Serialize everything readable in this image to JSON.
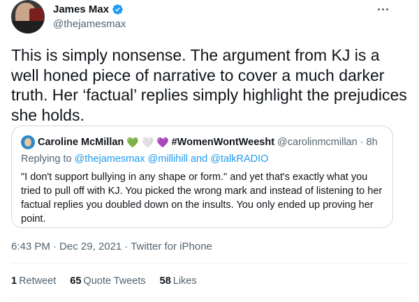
{
  "author": {
    "name": "James Max",
    "handle": "@thejamesmax"
  },
  "tweet": {
    "text": "This is simply nonsense. The argument from KJ is a well honed piece of narrative to cover a much darker truth. Her ‘factual’ replies simply highlight the prejudices she holds."
  },
  "quoted": {
    "name": "Caroline McMillan",
    "hearts": [
      "💚",
      "🤍",
      "💜"
    ],
    "hashtag": "#WomenWontWeesht",
    "handle": "@carolinmcmillan",
    "time": "· 8h",
    "replying_prefix": "Replying to",
    "replying_to": "@thejamesmax @millihill and @talkRADIO",
    "text": "\"I don't support bullying in any shape or form.\" and yet that's exactly what you tried to pull off with KJ. You picked the wrong mark and instead of listening to her factual replies you doubled down on the insults. You only ended up proving her point."
  },
  "meta": {
    "time": "6:43 PM",
    "date": "· Dec 29, 2021",
    "source": "· Twitter for iPhone"
  },
  "stats": {
    "retweets_num": "1",
    "retweets_label": "Retweet",
    "quotes_num": "65",
    "quotes_label": "Quote Tweets",
    "likes_num": "58",
    "likes_label": "Likes"
  },
  "colors": {
    "verified": "#1d9bf0",
    "link": "#1d9bf0",
    "secondary": "#536471"
  }
}
